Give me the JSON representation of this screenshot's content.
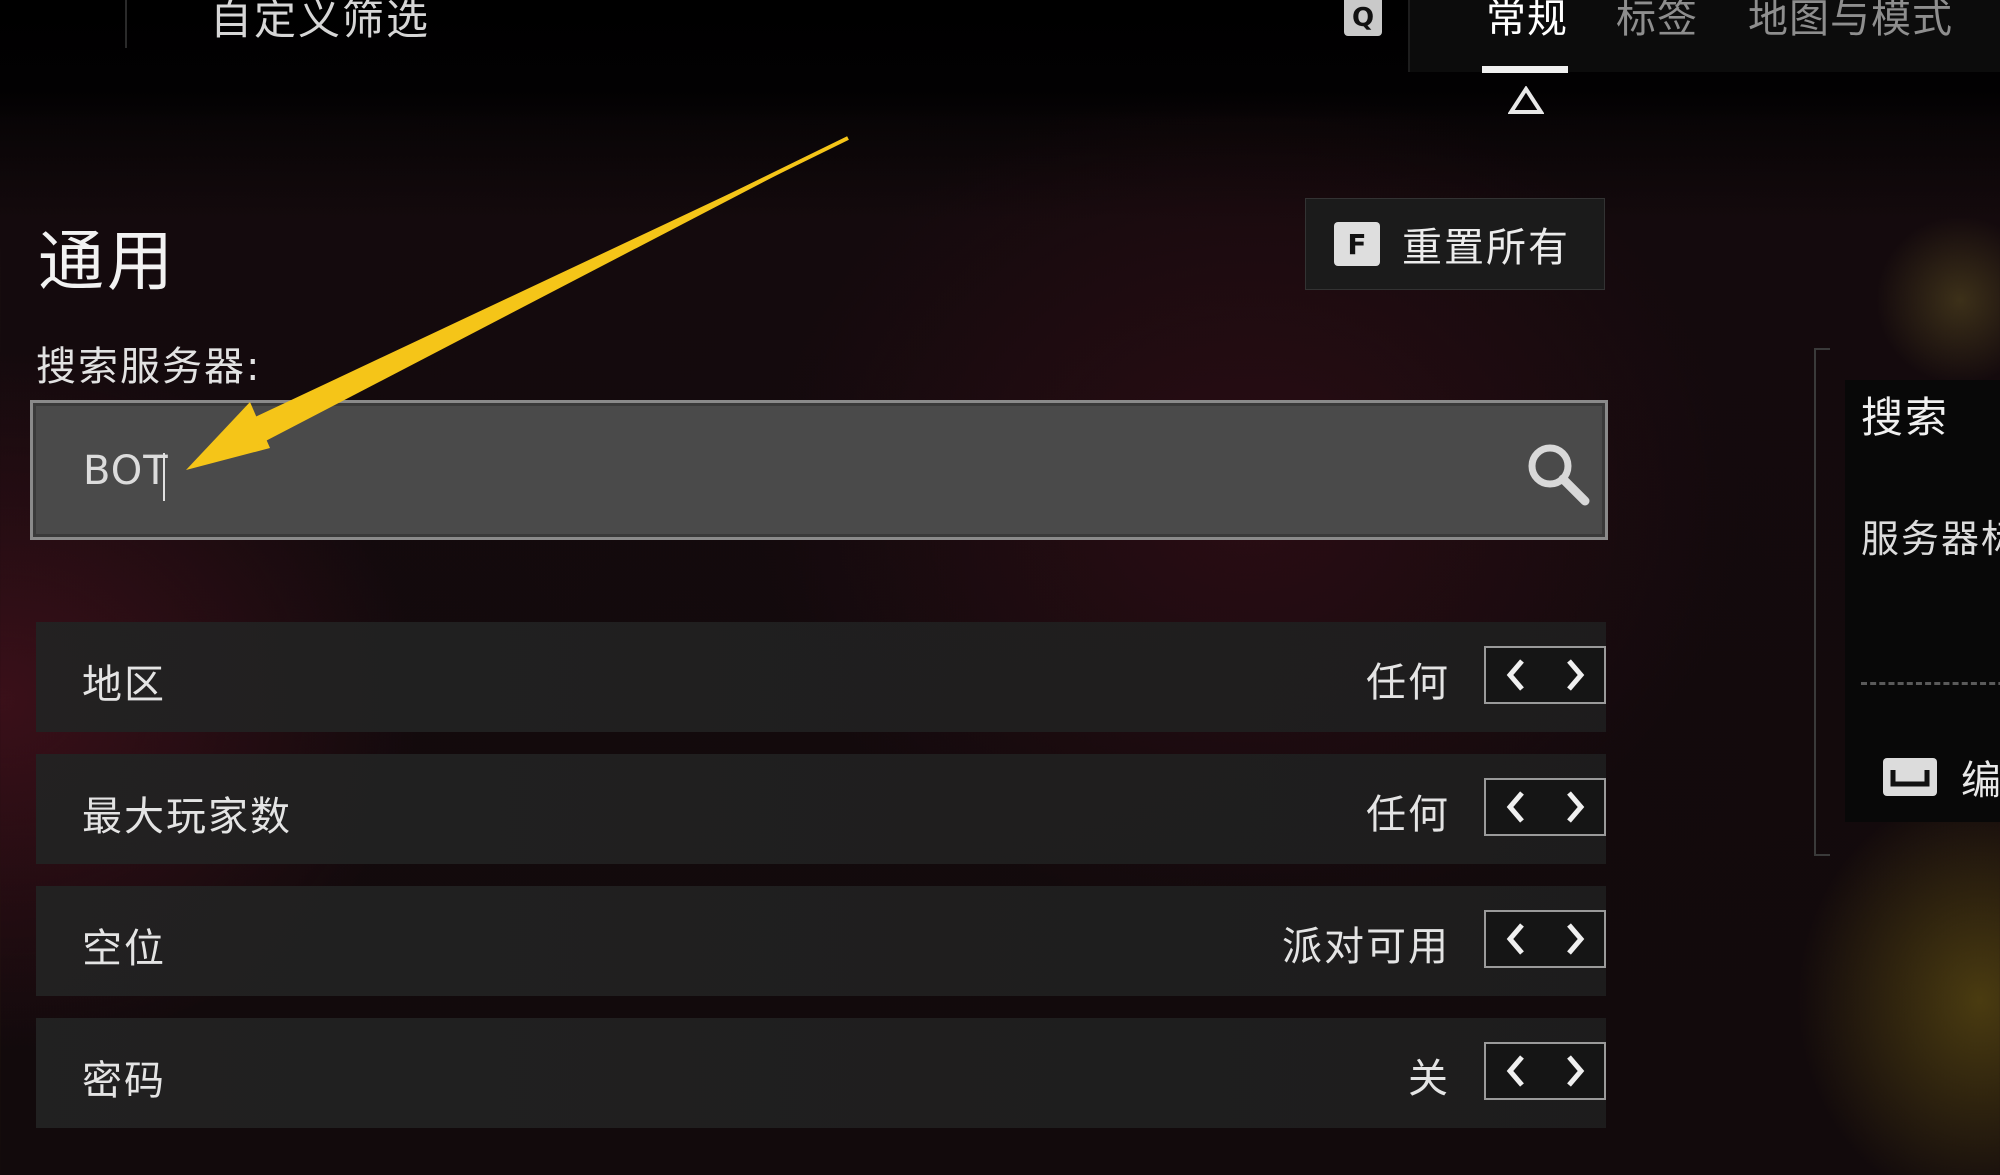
{
  "header": {
    "title": "自定义筛选",
    "key_hint": "Q",
    "tabs": [
      {
        "label": "常规",
        "active": true
      },
      {
        "label": "标签",
        "active": false
      },
      {
        "label": "地图与模式",
        "active": false
      }
    ]
  },
  "section": {
    "title": "通用",
    "reset": {
      "key": "F",
      "label": "重置所有"
    }
  },
  "search": {
    "label": "搜索服务器:",
    "value": "BOT",
    "icon": "search-icon"
  },
  "filters": [
    {
      "label": "地区",
      "value": "任何"
    },
    {
      "label": "最大玩家数",
      "value": "任何"
    },
    {
      "label": "空位",
      "value": "派对可用"
    },
    {
      "label": "密码",
      "value": "关"
    }
  ],
  "side_panel": {
    "title": "搜索",
    "subtitle": "服务器标",
    "edit_label": "编"
  },
  "colors": {
    "annotation_arrow": "#f5c518",
    "background": "#120a0c",
    "search_field": "#4a4a4a"
  }
}
